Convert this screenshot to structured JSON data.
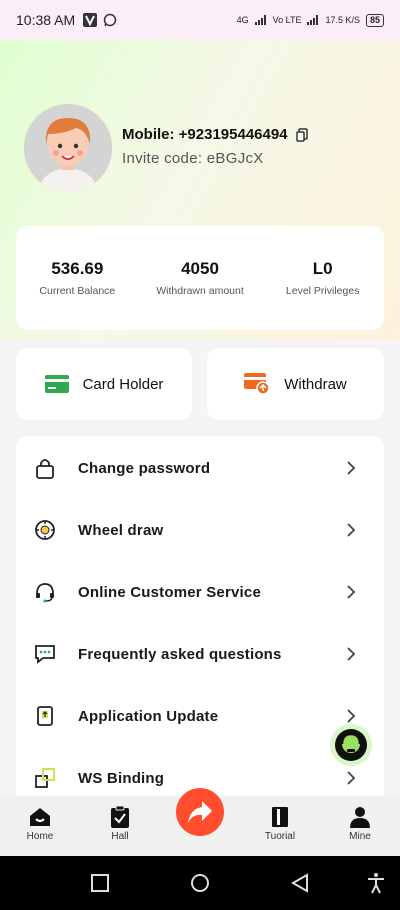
{
  "status_bar": {
    "time": "10:38 AM",
    "network": "4G",
    "lte": "Vo LTE",
    "speed": "17.5 K/S",
    "battery": "85"
  },
  "profile": {
    "mobile_label": "Mobile: +923195446494",
    "invite_label": "Invite code: eBGJcX"
  },
  "stats": [
    {
      "value": "536.69",
      "label": "Current Balance"
    },
    {
      "value": "4050",
      "label": "Withdrawn amount"
    },
    {
      "value": "L0",
      "label": "Level Privileges"
    }
  ],
  "quick_actions": {
    "card_holder": "Card Holder",
    "withdraw": "Withdraw"
  },
  "menu": [
    {
      "label": "Change password",
      "icon": "lock-icon"
    },
    {
      "label": "Wheel draw",
      "icon": "wheel-icon"
    },
    {
      "label": "Online Customer Service",
      "icon": "headset-icon"
    },
    {
      "label": "Frequently asked questions",
      "icon": "chat-icon"
    },
    {
      "label": "Application Update",
      "icon": "update-icon"
    },
    {
      "label": "WS Binding",
      "icon": "link-icon"
    }
  ],
  "tabbar": {
    "home": "Home",
    "hall": "Hall",
    "tutorial": "Tuorial",
    "mine": "Mine"
  },
  "colors": {
    "accent": "#ff4d2e",
    "card_icon": "#2fa84f",
    "withdraw_icon": "#f06a1d"
  }
}
